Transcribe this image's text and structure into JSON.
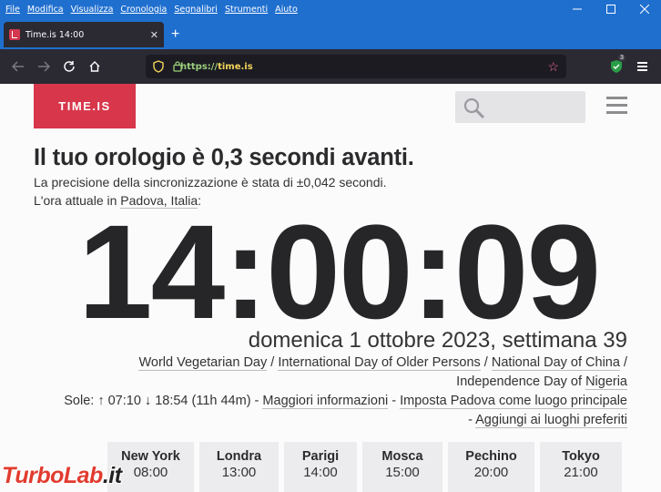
{
  "menubar": {
    "items": [
      "File",
      "Modifica",
      "Visualizza",
      "Cronologia",
      "Segnalibri",
      "Strumenti",
      "Aiuto"
    ]
  },
  "window_controls": [
    "minimize-icon",
    "maximize-icon",
    "close-icon"
  ],
  "tab": {
    "title": "Time.is 14:00",
    "close": "✕"
  },
  "newtab": "+",
  "navbar": {
    "url_scheme": "https://",
    "url_host": "time.is",
    "extension_count": "3"
  },
  "page": {
    "logo": "TIME.IS",
    "headline": "Il tuo orologio è 0,3 secondi avanti.",
    "subline": "La precisione della sincronizzazione è stata di ±0,042 secondi.",
    "current_prefix": "L'ora attuale in ",
    "current_place": "Padova, Italia",
    "current_suffix": ":",
    "clock": "14:00:09",
    "date": "domenica 1 ottobre 2023, settimana 39",
    "events": {
      "e1": "World Vegetarian Day",
      "sep": " / ",
      "e2": "International Day of Older Persons",
      "e3": "National Day of China",
      "e4_prefix": "Independence Day of ",
      "e4_link": "Nigeria"
    },
    "sun": {
      "text": "Sole: ↑ 07:10 ↓ 18:54 (11h 44m) - ",
      "more": "Maggiori informazioni",
      "dash": " - ",
      "set_home": "Imposta Padova come luogo principale",
      "add_fav": "Aggiungi ai luoghi preferiti"
    },
    "cities": [
      {
        "name": "New York",
        "time": "08:00"
      },
      {
        "name": "Londra",
        "time": "13:00"
      },
      {
        "name": "Parigi",
        "time": "14:00"
      },
      {
        "name": "Mosca",
        "time": "15:00"
      },
      {
        "name": "Pechino",
        "time": "20:00"
      },
      {
        "name": "Tokyo",
        "time": "21:00"
      }
    ]
  },
  "watermark": {
    "a": "TurboLab",
    "b": ".it"
  }
}
